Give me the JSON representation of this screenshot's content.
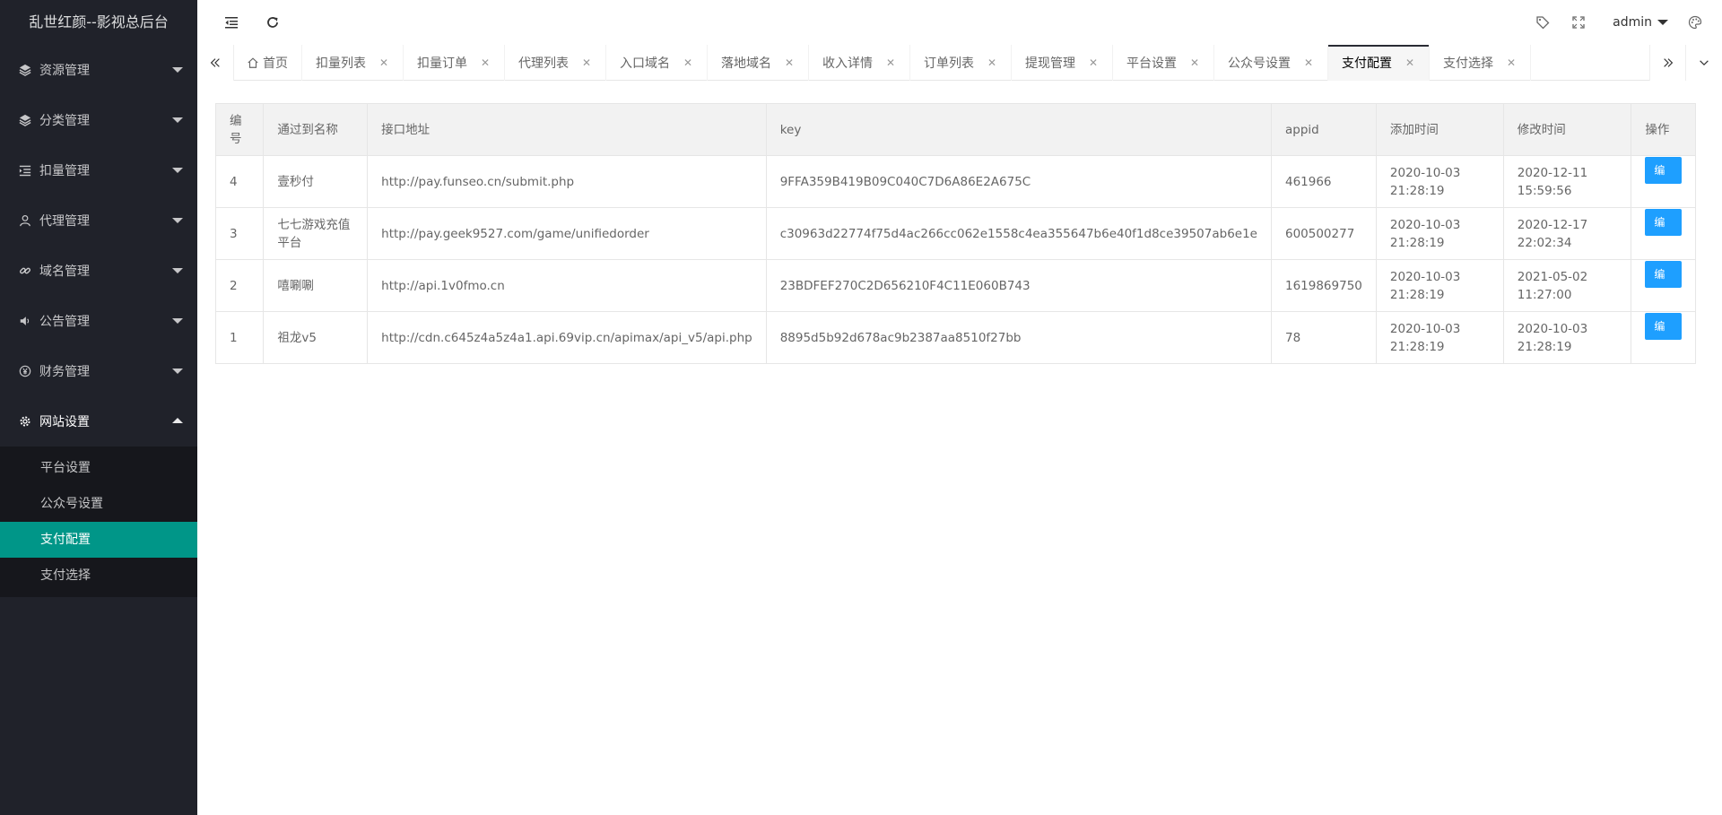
{
  "sidebar": {
    "logo": "乱世红颜--影视总后台",
    "menu": [
      {
        "label": "资源管理",
        "icon": "layers-icon"
      },
      {
        "label": "分类管理",
        "icon": "layers-icon"
      },
      {
        "label": "扣量管理",
        "icon": "list-indent-icon"
      },
      {
        "label": "代理管理",
        "icon": "user-icon"
      },
      {
        "label": "域名管理",
        "icon": "link-icon"
      },
      {
        "label": "公告管理",
        "icon": "speaker-icon"
      },
      {
        "label": "财务管理",
        "icon": "yen-icon"
      },
      {
        "label": "网站设置",
        "icon": "gear-icon"
      }
    ],
    "submenu": [
      {
        "label": "平台设置"
      },
      {
        "label": "公众号设置"
      },
      {
        "label": "支付配置"
      },
      {
        "label": "支付选择"
      }
    ]
  },
  "header": {
    "user": "admin",
    "icons": [
      "menu-collapse-icon",
      "refresh-icon",
      "tag-icon",
      "fullscreen-icon",
      "palette-icon"
    ]
  },
  "tabs": [
    {
      "label": "首页"
    },
    {
      "label": "扣量列表"
    },
    {
      "label": "扣量订单"
    },
    {
      "label": "代理列表"
    },
    {
      "label": "入口域名"
    },
    {
      "label": "落地域名"
    },
    {
      "label": "收入详情"
    },
    {
      "label": "订单列表"
    },
    {
      "label": "提现管理"
    },
    {
      "label": "平台设置"
    },
    {
      "label": "公众号设置"
    },
    {
      "label": "支付配置"
    },
    {
      "label": "支付选择"
    }
  ],
  "table": {
    "headers": {
      "id": "编号",
      "name": "通过到名称",
      "url": "接口地址",
      "key": "key",
      "appid": "appid",
      "created": "添加时间",
      "modified": "修改时间",
      "action": "操作"
    },
    "rows": [
      {
        "id": "4",
        "name": "壹秒付",
        "url": "http://pay.funseo.cn/submit.php",
        "key": "9FFA359B419B09C040C7D6A86E2A675C",
        "appid": "461966",
        "created": "2020-10-03 21:28:19",
        "modified": "2020-12-11 15:59:56",
        "action": "编辑"
      },
      {
        "id": "3",
        "name": "七七游戏充值平台",
        "url": "http://pay.geek9527.com/game/unifiedorder",
        "key": "c30963d22774f75d4ac266cc062e1558c4ea355647b6e40f1d8ce39507ab6e1e",
        "appid": "600500277",
        "created": "2020-10-03 21:28:19",
        "modified": "2020-12-17 22:02:34",
        "action": "编辑"
      },
      {
        "id": "2",
        "name": "嘻唰唰",
        "url": "http://api.1v0fmo.cn",
        "key": "23BDFEF270C2D656210F4C11E060B743",
        "appid": "1619869750",
        "created": "2020-10-03 21:28:19",
        "modified": "2021-05-02 11:27:00",
        "action": "编辑"
      },
      {
        "id": "1",
        "name": "祖龙v5",
        "url": "http://cdn.c645z4a5z4a1.api.69vip.cn/apimax/api_v5/api.php",
        "key": "8895d5b92d678ac9b2387aa8510f27bb",
        "appid": "78",
        "created": "2020-10-03 21:28:19",
        "modified": "2020-10-03 21:28:19",
        "action": "编辑"
      }
    ]
  },
  "colors": {
    "sidebar_bg": "#20222a",
    "submenu_bg": "#16171c",
    "active_item": "#009688",
    "edit_button": "#1e9fff"
  }
}
